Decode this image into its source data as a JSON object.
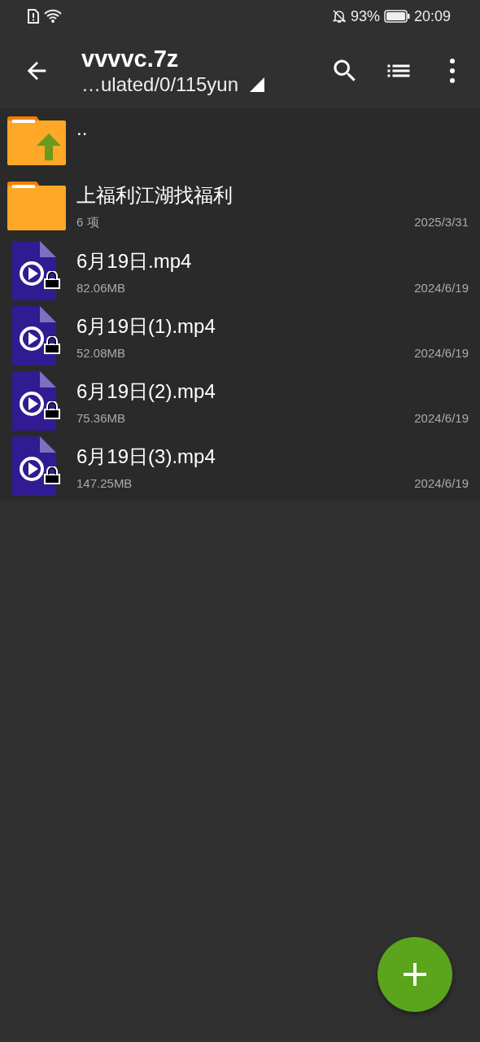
{
  "status_bar": {
    "battery": "93%",
    "time": "20:09"
  },
  "toolbar": {
    "title": "vvvvc.7z",
    "path": "…ulated/0/115yun"
  },
  "items": [
    {
      "kind": "parent",
      "name": "..",
      "locked": false
    },
    {
      "kind": "folder",
      "name": "上福利江湖找福利",
      "info": "6 项",
      "date": "2025/3/31",
      "locked": false
    },
    {
      "kind": "video",
      "name": "6月19日.mp4",
      "info": "82.06MB",
      "date": "2024/6/19",
      "locked": true
    },
    {
      "kind": "video",
      "name": "6月19日(1).mp4",
      "info": "52.08MB",
      "date": "2024/6/19",
      "locked": true
    },
    {
      "kind": "video",
      "name": "6月19日(2).mp4",
      "info": "75.36MB",
      "date": "2024/6/19",
      "locked": true
    },
    {
      "kind": "video",
      "name": "6月19日(3).mp4",
      "info": "147.25MB",
      "date": "2024/6/19",
      "locked": true
    }
  ]
}
